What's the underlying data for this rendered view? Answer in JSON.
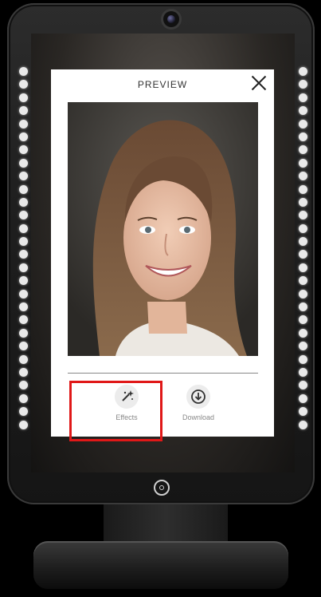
{
  "card": {
    "title": "PREVIEW"
  },
  "actions": [
    {
      "label": "Effects",
      "icon": "sparkle-wand-icon"
    },
    {
      "label": "Download",
      "icon": "download-circle-icon"
    }
  ],
  "colors": {
    "highlight": "#e01818",
    "led": "#e9e9e9",
    "kiosk_frame": "#1f1f1f",
    "card_bg": "#ffffff"
  }
}
